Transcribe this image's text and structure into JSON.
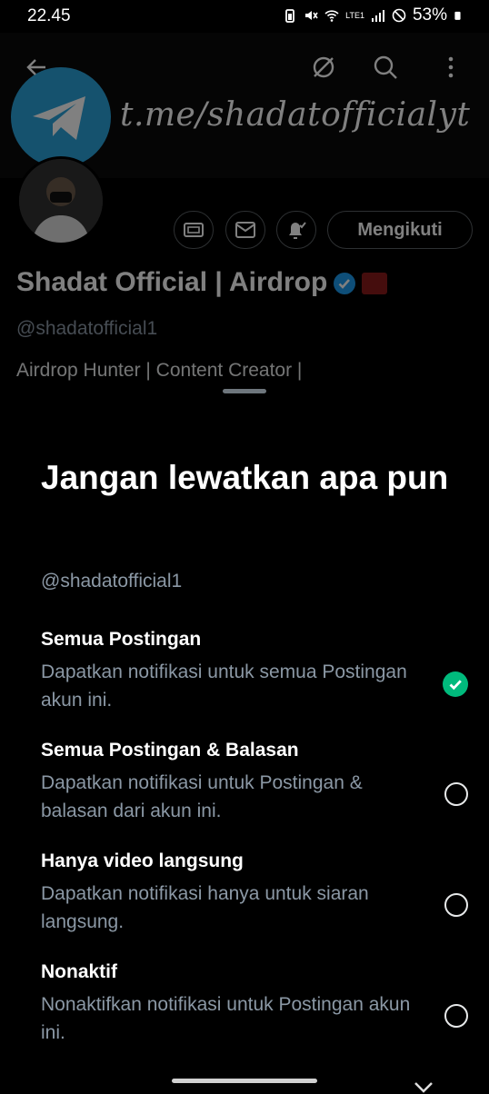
{
  "status_bar": {
    "time": "22.45",
    "battery": "53%",
    "network": "LTE1"
  },
  "profile": {
    "banner_text": "t.me/shadatofficialyt",
    "follow_button": "Mengikuti",
    "name": "Shadat Official | Airdrop",
    "handle": "@shadatofficial1",
    "bio": "Airdrop Hunter | Content Creator |",
    "icons": [
      "back-icon",
      "hide-icon",
      "search-icon",
      "more-icon",
      "subscribe-icon",
      "message-icon",
      "notification-icon",
      "verified-icon"
    ],
    "colors": {
      "verified": "#1d9bf0",
      "telegram": "#2aa3dc"
    }
  },
  "sheet": {
    "title": "Jangan lewatkan apa pun",
    "handle": "@shadatofficial1",
    "options": [
      {
        "title": "Semua Postingan",
        "desc": "Dapatkan notifikasi untuk semua Postingan akun ini.",
        "selected": true
      },
      {
        "title": "Semua Postingan & Balasan",
        "desc": "Dapatkan notifikasi untuk Postingan & balasan dari akun ini.",
        "selected": false
      },
      {
        "title": "Hanya video langsung",
        "desc": "Dapatkan notifikasi hanya untuk siaran langsung.",
        "selected": false
      },
      {
        "title": "Nonaktif",
        "desc": "Nonaktifkan notifikasi untuk Postingan akun ini.",
        "selected": false
      }
    ],
    "colors": {
      "selected": "#00ba7c"
    }
  }
}
